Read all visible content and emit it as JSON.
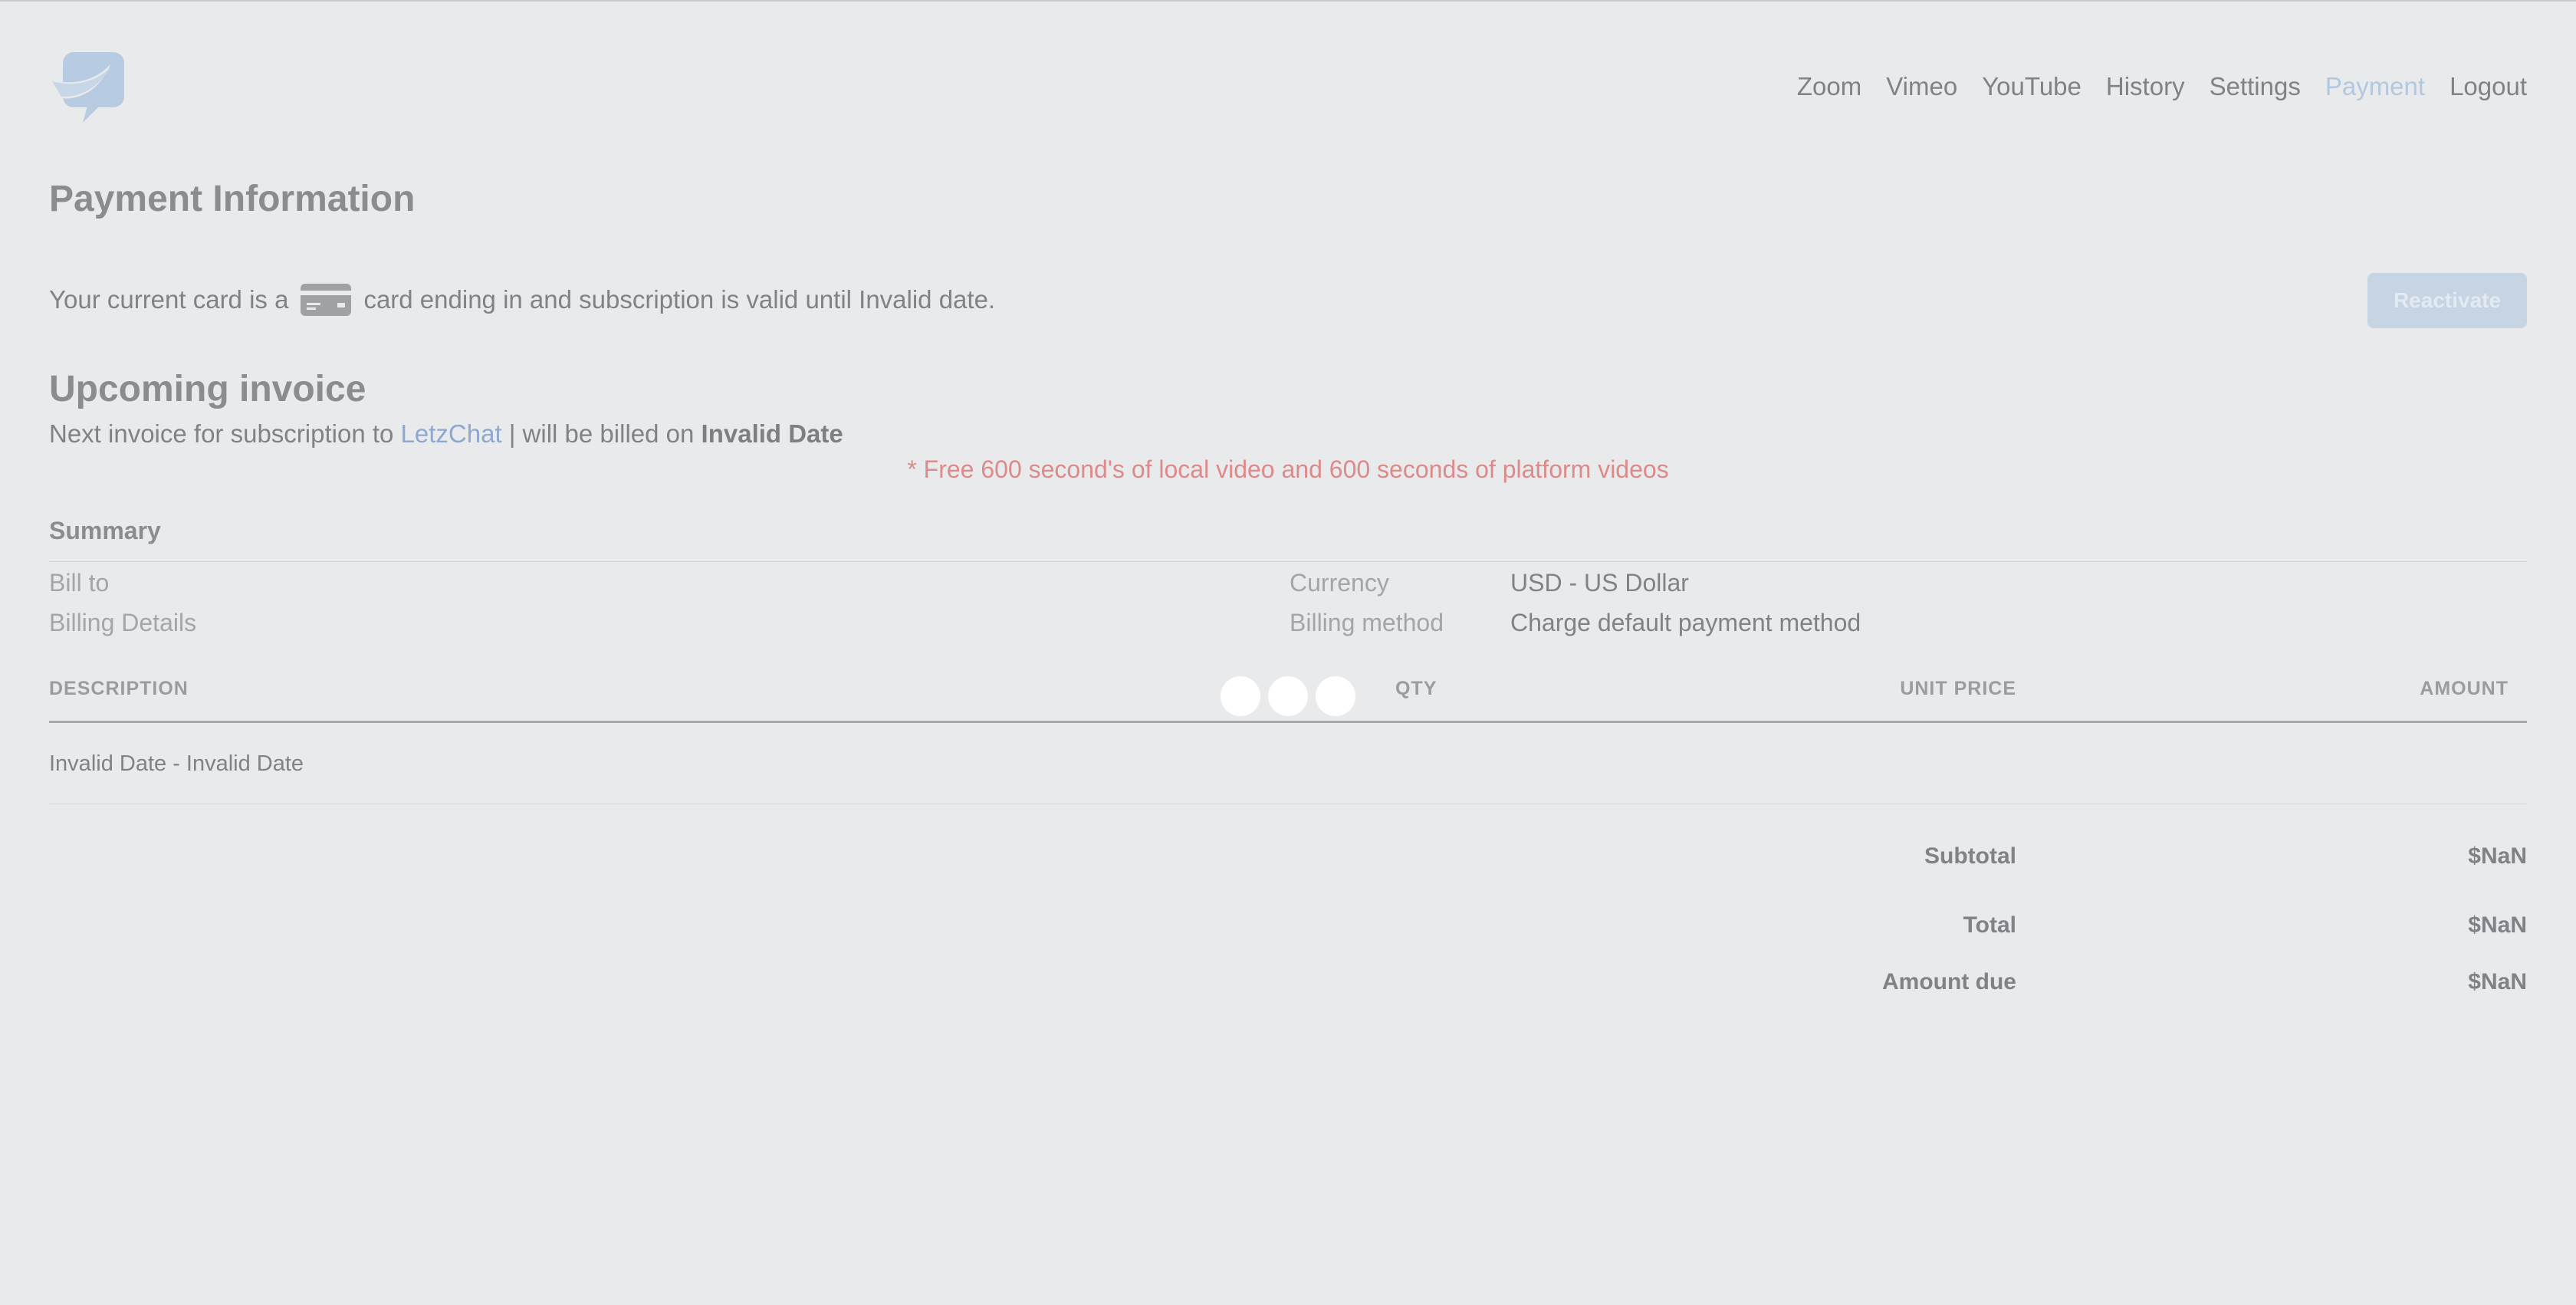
{
  "nav": {
    "items": [
      {
        "label": "Zoom",
        "active": false
      },
      {
        "label": "Vimeo",
        "active": false
      },
      {
        "label": "YouTube",
        "active": false
      },
      {
        "label": "History",
        "active": false
      },
      {
        "label": "Settings",
        "active": false
      },
      {
        "label": "Payment",
        "active": true
      },
      {
        "label": "Logout",
        "active": false
      }
    ]
  },
  "payment": {
    "title": "Payment Information",
    "card_text_before": "Your current card is a",
    "card_icon": "credit-card-icon",
    "card_text_after": "card ending in and subscription is valid until Invalid date.",
    "reactivate_label": "Reactivate"
  },
  "invoice": {
    "title": "Upcoming invoice",
    "next_prefix": "Next invoice for subscription to",
    "plan_link": "LetzChat",
    "next_middle": "| will be billed on",
    "billing_date": "Invalid Date",
    "free_note": "* Free 600 second's of local video and 600 seconds of platform videos"
  },
  "summary": {
    "title": "Summary",
    "bill_to_label": "Bill to",
    "billing_details_label": "Billing Details",
    "currency_label": "Currency",
    "currency_value": "USD - US Dollar",
    "billing_method_label": "Billing method",
    "billing_method_value": "Charge default payment method"
  },
  "table": {
    "headers": {
      "description": "DESCRIPTION",
      "qty": "QTY",
      "unit_price": "UNIT PRICE",
      "amount": "AMOUNT"
    },
    "rows": [
      {
        "description": "Invalid Date - Invalid Date",
        "qty": "",
        "unit_price": "",
        "amount": ""
      }
    ]
  },
  "totals": {
    "subtotal_label": "Subtotal",
    "subtotal_value": "$NaN",
    "total_label": "Total",
    "total_value": "$NaN",
    "amount_due_label": "Amount due",
    "amount_due_value": "$NaN"
  },
  "colors": {
    "background": "#e9eaec",
    "accent_link": "#8ea8cf",
    "active_nav": "#b2c8de",
    "note_red": "#dc8a8a",
    "button_bg": "#c6d4e3"
  }
}
